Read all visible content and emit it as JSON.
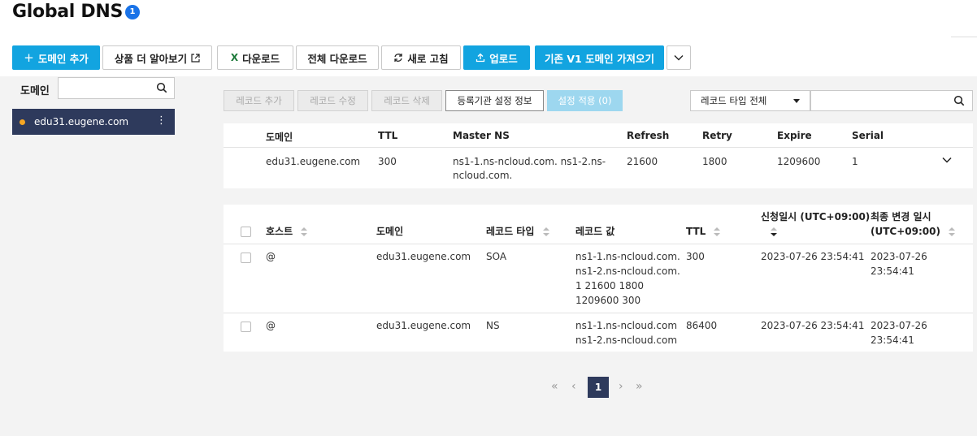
{
  "header": {
    "title": "Global DNS",
    "badge": "1"
  },
  "toolbar": {
    "add_domain": "도메인 추가",
    "learn_more": "상품 더 알아보기",
    "download": "다운로드",
    "download_all": "전체 다운로드",
    "refresh": "새로 고침",
    "upload": "업로드",
    "import_v1": "기존 V1 도메인 가져오기"
  },
  "sidebar": {
    "label": "도메인",
    "search_placeholder": "",
    "items": [
      {
        "name": "edu31.eugene.com"
      }
    ]
  },
  "record_actions": {
    "add": "레코드 추가",
    "edit": "레코드 수정",
    "delete": "레코드 삭제",
    "registrar": "등록기관 설정 정보",
    "apply": "설정 적용 (0)"
  },
  "filter": {
    "type_selected": "레코드 타입 전체",
    "search_placeholder": ""
  },
  "soa": {
    "headers": [
      "도메인",
      "TTL",
      "Master NS",
      "Refresh",
      "Retry",
      "Expire",
      "Serial"
    ],
    "row": {
      "domain": "edu31.eugene.com",
      "ttl": "300",
      "master_ns_1": "ns1-1.ns-ncloud.com. ns1-2.ns-",
      "master_ns_2": "ncloud.com.",
      "refresh": "21600",
      "retry": "1800",
      "expire": "1209600",
      "serial": "1"
    }
  },
  "records": {
    "headers": {
      "host": "호스트",
      "domain": "도메인",
      "type": "레코드 타입",
      "value": "레코드 값",
      "ttl": "TTL",
      "created_1": "신청일시 (UTC+09:00)",
      "modified_1": "최종 변경 일시",
      "modified_2": "(UTC+09:00)"
    },
    "rows": [
      {
        "host": "@",
        "domain": "edu31.eugene.com",
        "type": "SOA",
        "value_lines": [
          "ns1-1.ns-ncloud.com.",
          "ns1-2.ns-ncloud.com.",
          "1 21600 1800",
          "1209600 300"
        ],
        "ttl": "300",
        "created": "2023-07-26 23:54:41",
        "modified_1": "2023-07-26",
        "modified_2": "23:54:41"
      },
      {
        "host": "@",
        "domain": "edu31.eugene.com",
        "type": "NS",
        "value_lines": [
          "ns1-1.ns-ncloud.com",
          "ns1-2.ns-ncloud.com"
        ],
        "ttl": "86400",
        "created": "2023-07-26 23:54:41",
        "modified_1": "2023-07-26",
        "modified_2": "23:54:41"
      }
    ]
  },
  "pagination": {
    "current": "1",
    "first": "«",
    "prev": "‹",
    "next": "›",
    "last": "»"
  }
}
